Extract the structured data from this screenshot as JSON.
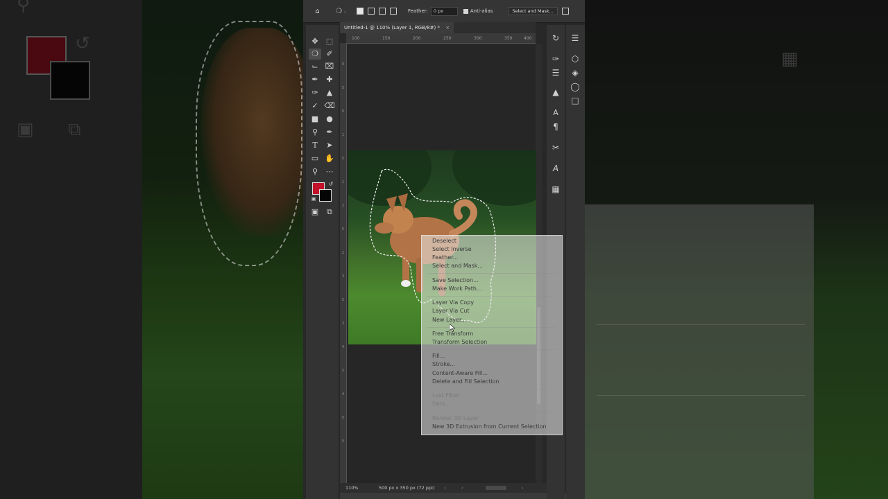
{
  "optionsBar": {
    "featherLabel": "Feather:",
    "featherValue": "0 px",
    "antiAliasLabel": "Anti-alias",
    "selectAndMaskLabel": "Select and Mask..."
  },
  "document": {
    "tabTitle": "Untitled-1 @ 110% (Layer 1, RGB/8#) *",
    "zoom": "110%",
    "info": "500 px x 350 px (72 ppi)"
  },
  "rulerTop": [
    "100",
    "150",
    "200",
    "250",
    "300",
    "350",
    "400"
  ],
  "rulerLeft": [
    "0",
    "5",
    "0",
    "1",
    "5",
    "1",
    "2",
    "5",
    "2",
    "3",
    "5",
    "3",
    "4",
    "5",
    "4",
    "5",
    "5"
  ],
  "contextMenu": {
    "items": [
      {
        "label": "Deselect",
        "enabled": true
      },
      {
        "label": "Select Inverse",
        "enabled": true
      },
      {
        "label": "Feather...",
        "enabled": true
      },
      {
        "label": "Select and Mask...",
        "enabled": true
      },
      {
        "label": "Save Selection...",
        "enabled": true
      },
      {
        "label": "Make Work Path...",
        "enabled": true
      },
      {
        "label": "Layer Via Copy",
        "enabled": true
      },
      {
        "label": "Layer Via Cut",
        "enabled": true
      },
      {
        "label": "New Layer...",
        "enabled": true
      },
      {
        "label": "Free Transform",
        "enabled": true
      },
      {
        "label": "Transform Selection",
        "enabled": true
      },
      {
        "label": "Fill...",
        "enabled": true
      },
      {
        "label": "Stroke...",
        "enabled": true
      },
      {
        "label": "Content-Aware Fill...",
        "enabled": true
      },
      {
        "label": "Delete and Fill Selection",
        "enabled": true
      },
      {
        "label": "Last Filter",
        "enabled": false
      },
      {
        "label": "Fade...",
        "enabled": false
      },
      {
        "label": "Render 3D Layer",
        "enabled": false
      },
      {
        "label": "New 3D Extrusion from Current Selection",
        "enabled": true
      }
    ]
  },
  "colors": {
    "foreground": "#c4112a",
    "background": "#050505",
    "uiDark": "#282828",
    "panel": "#333333"
  },
  "icons": {
    "home": "home-icon",
    "lasso": "lasso-icon",
    "move": "move-icon"
  }
}
